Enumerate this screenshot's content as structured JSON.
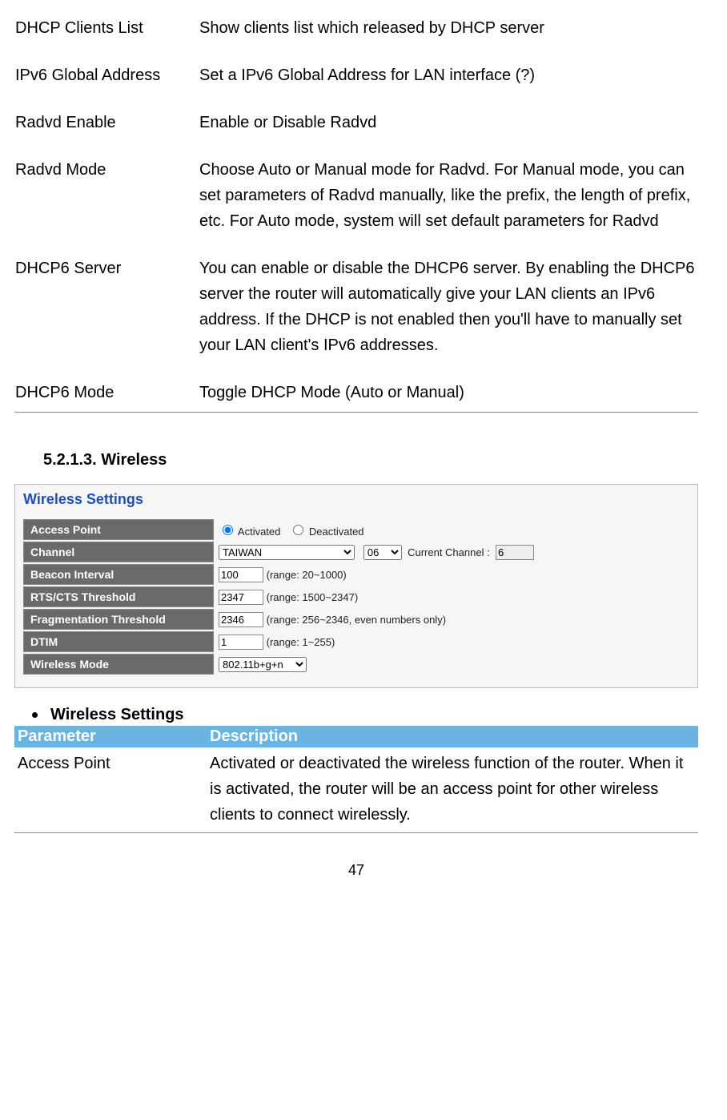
{
  "top_rows": [
    {
      "param": "DHCP Clients List",
      "desc": "Show clients list which released by DHCP server"
    },
    {
      "param": "IPv6 Global Address",
      "desc": "Set a IPv6 Global Address for LAN interface (?)"
    },
    {
      "param": "Radvd Enable",
      "desc": "Enable or Disable Radvd"
    },
    {
      "param": "Radvd Mode",
      "desc": "Choose Auto or Manual mode for Radvd. For Manual mode, you can set parameters of Radvd manually, like the prefix, the length of prefix, etc. For Auto mode, system will set default parameters for Radvd"
    },
    {
      "param": "DHCP6 Server",
      "desc": "You can enable or disable the DHCP6 server. By enabling the DHCP6 server the router will automatically give your LAN clients an IPv6 address. If the DHCP is not enabled then you'll have to manually set your LAN client's IPv6 addresses."
    },
    {
      "param": "DHCP6 Mode",
      "desc": "Toggle DHCP Mode (Auto or Manual)"
    }
  ],
  "section_heading": "5.2.1.3. Wireless",
  "panel": {
    "title": "Wireless Settings",
    "access_point": {
      "label": "Access Point",
      "activated": "Activated",
      "deactivated": "Deactivated"
    },
    "channel": {
      "label": "Channel",
      "country": "TAIWAN",
      "channel_value": "06",
      "current_label": "Current Channel :",
      "current_value": "6"
    },
    "beacon": {
      "label": "Beacon Interval",
      "value": "100",
      "range": "(range: 20~1000)"
    },
    "rts": {
      "label": "RTS/CTS Threshold",
      "value": "2347",
      "range": "(range: 1500~2347)"
    },
    "frag": {
      "label": "Fragmentation Threshold",
      "value": "2346",
      "range": "(range: 256~2346, even numbers only)"
    },
    "dtim": {
      "label": "DTIM",
      "value": "1",
      "range": "(range: 1~255)"
    },
    "mode": {
      "label": "Wireless Mode",
      "value": "802.11b+g+n"
    }
  },
  "bullet_heading": "Wireless Settings",
  "desc_header": {
    "param": "Parameter",
    "desc": "Description"
  },
  "desc_rows": [
    {
      "param": "Access Point",
      "desc": "Activated or deactivated the wireless function of the router. When it is activated, the router will be an access point for other wireless clients to connect wirelessly."
    }
  ],
  "page_number": "47"
}
